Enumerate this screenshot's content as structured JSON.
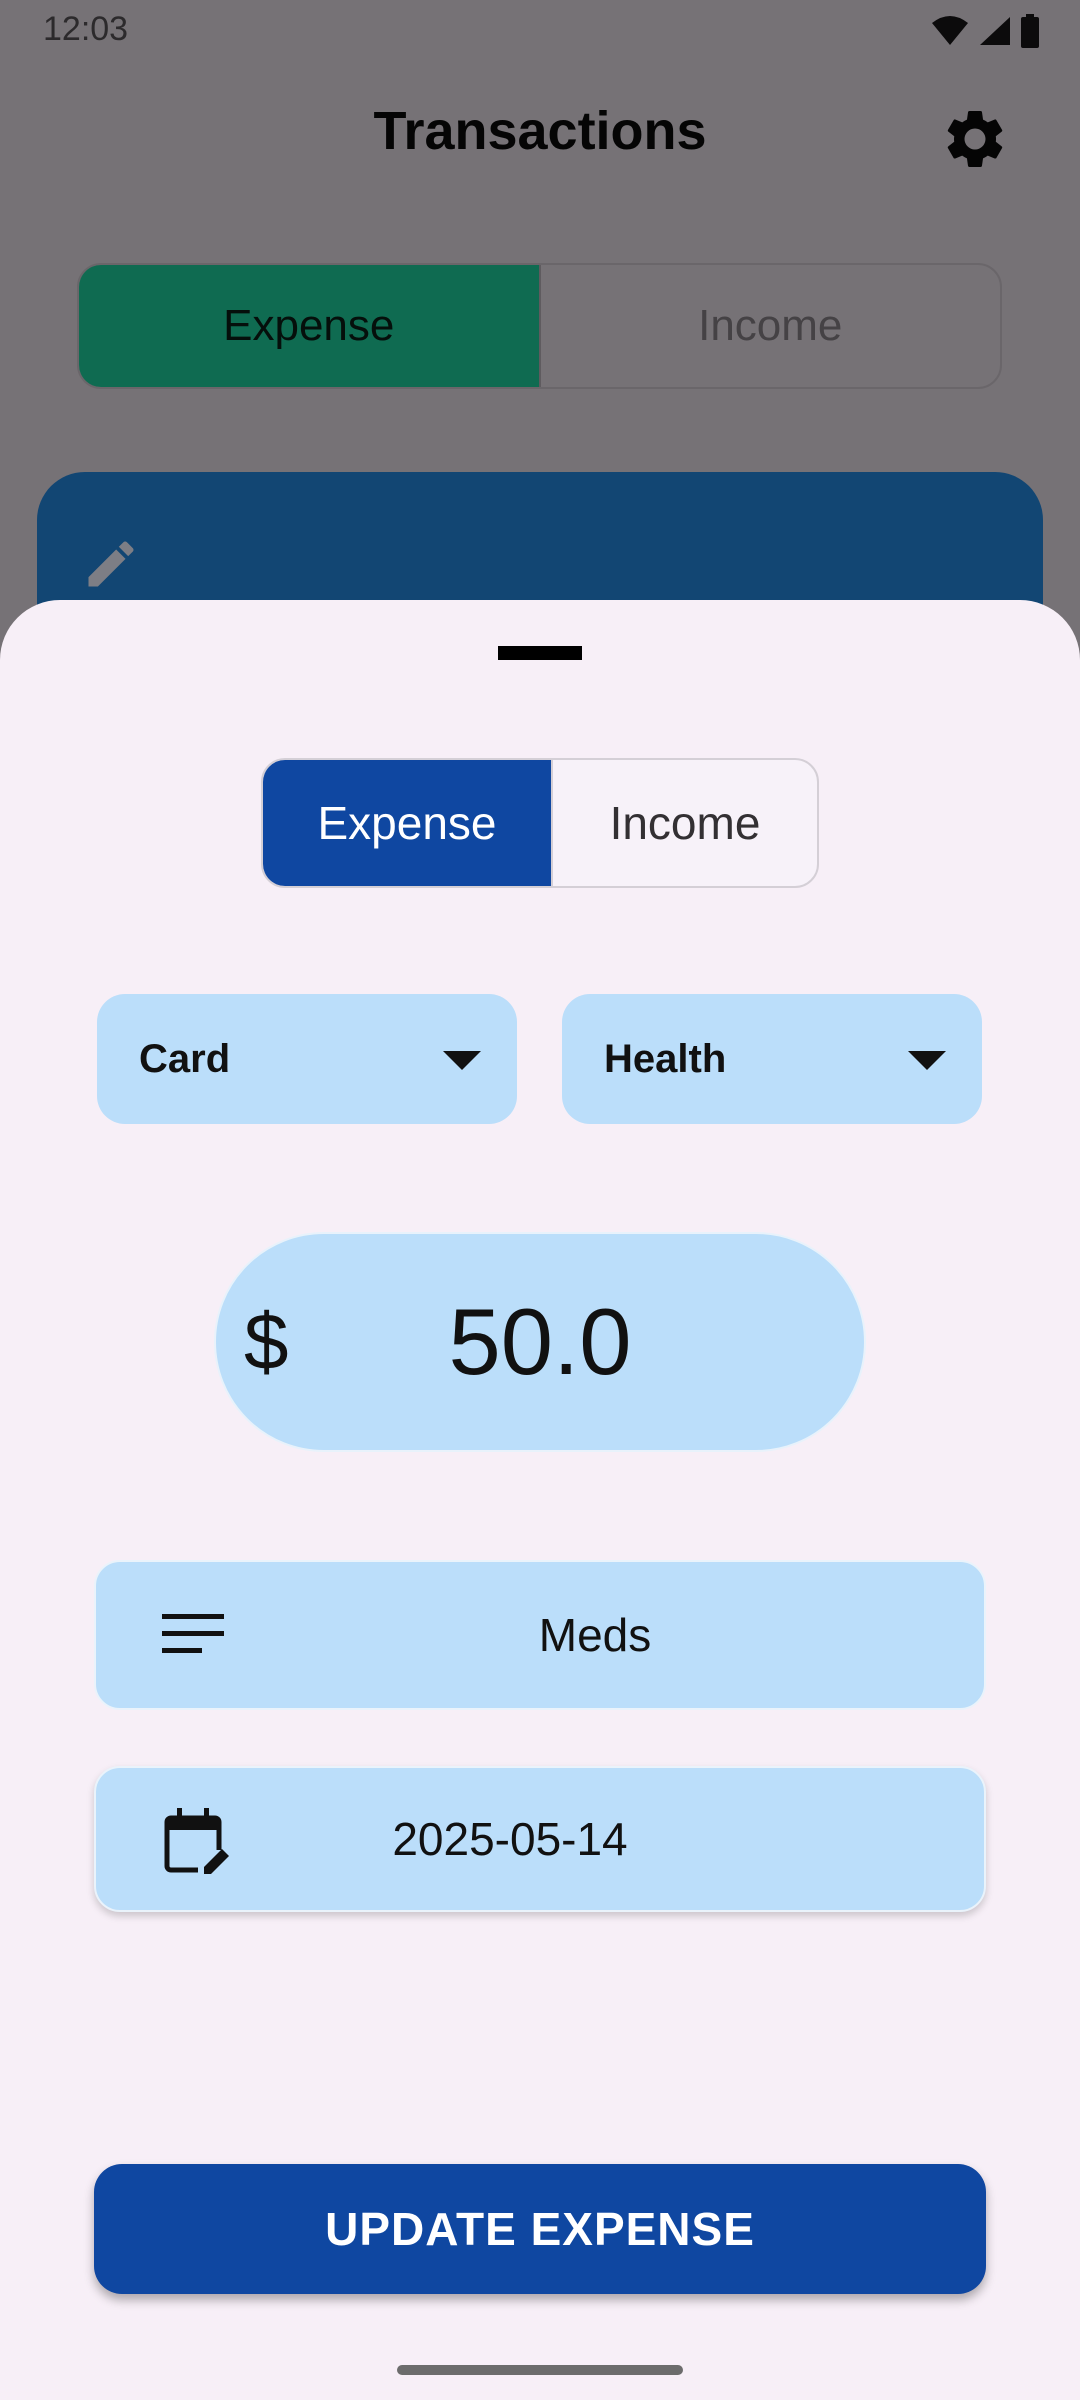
{
  "status_bar": {
    "time": "12:03",
    "icons": [
      "wifi-icon",
      "signal-icon",
      "battery-icon"
    ]
  },
  "app_bar": {
    "title": "Transactions",
    "settings_icon": "gear-icon"
  },
  "background_tabs": {
    "items": [
      "Expense",
      "Income"
    ],
    "selected": "Expense",
    "active_color": "#0f6b51"
  },
  "background_card": {
    "color": "#124673",
    "icon": "pencil-icon"
  },
  "sheet": {
    "type_toggle": {
      "items": [
        "Expense",
        "Income"
      ],
      "selected": "Expense",
      "active_color": "#0f47a1"
    },
    "payment_method": {
      "value": "Card"
    },
    "category": {
      "value": "Health"
    },
    "amount": {
      "currency": "$",
      "value": "50.0"
    },
    "note": {
      "icon": "notes-icon",
      "value": "Meds"
    },
    "date": {
      "icon": "calendar-edit-icon",
      "value": "2025-05-14"
    },
    "submit_label": "UPDATE EXPENSE",
    "field_color": "#bbdefa"
  }
}
